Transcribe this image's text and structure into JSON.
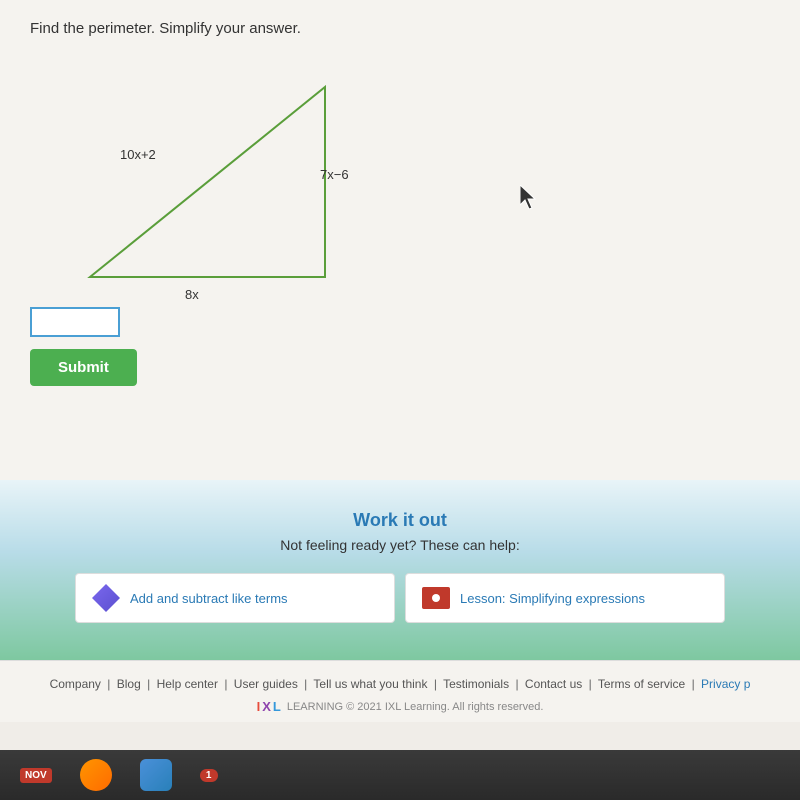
{
  "page": {
    "instruction": "Find the perimeter. Simplify your answer.",
    "triangle": {
      "side_left_label": "10x+2",
      "side_right_label": "7x−6",
      "side_bottom_label": "8x"
    },
    "answer_input": {
      "placeholder": "",
      "value": ""
    },
    "submit_button": "Submit",
    "work_it_out": {
      "title": "Work it out",
      "subtitle": "Not feeling ready yet? These can help:"
    },
    "resources": [
      {
        "icon": "diamond",
        "label": "Add and subtract like terms"
      },
      {
        "icon": "lesson",
        "label": "Lesson: Simplifying expressions"
      }
    ],
    "footer": {
      "links": [
        "Company",
        "Blog",
        "Help center",
        "User guides",
        "Tell us what you think",
        "Testimonials",
        "Contact us",
        "Terms of service",
        "Privacy p"
      ],
      "copyright": "LEARNING © 2021 IXL Learning. All rights reserved."
    }
  },
  "taskbar": {
    "month": "NOV",
    "badge_count": "1"
  }
}
